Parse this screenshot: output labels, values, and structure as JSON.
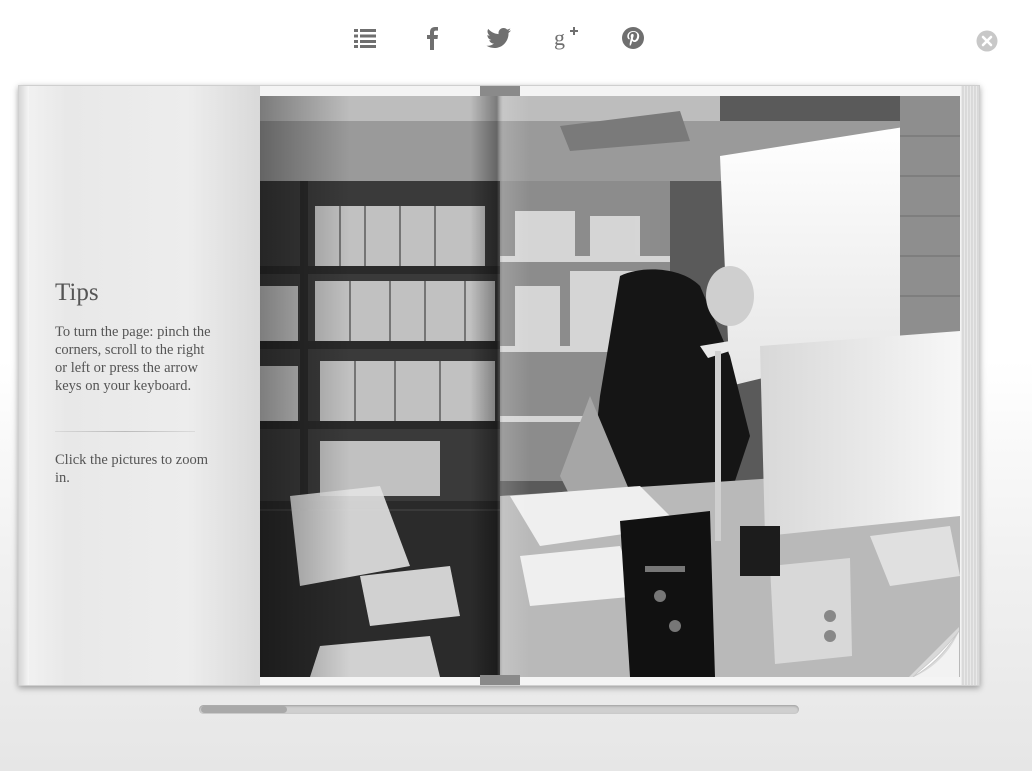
{
  "toolbar": {
    "icons": [
      "list-icon",
      "facebook-icon",
      "twitter-icon",
      "google-plus-icon",
      "pinterest-icon"
    ],
    "icon_color": "#6f6f6f"
  },
  "close": {
    "icon": "close-icon",
    "color": "#c8c8c8"
  },
  "tips": {
    "title": "Tips",
    "page_turn_text": "To turn the page: pinch the corners, scroll to the right or left or press the arrow keys on your keyboard.",
    "zoom_text": "Click the pictures to zoom in."
  },
  "scrollbar": {
    "position_fraction": 0.0
  }
}
